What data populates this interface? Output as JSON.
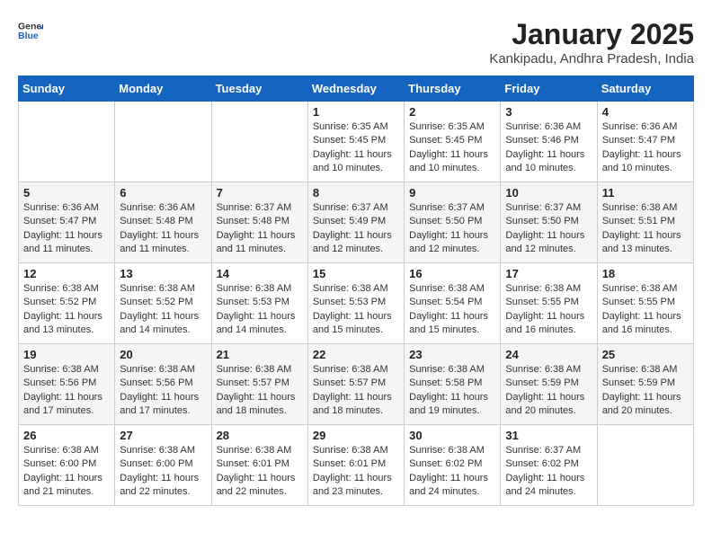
{
  "header": {
    "logo_general": "General",
    "logo_blue": "Blue",
    "title": "January 2025",
    "subtitle": "Kankipadu, Andhra Pradesh, India"
  },
  "weekdays": [
    "Sunday",
    "Monday",
    "Tuesday",
    "Wednesday",
    "Thursday",
    "Friday",
    "Saturday"
  ],
  "weeks": [
    [
      {
        "day": "",
        "info": ""
      },
      {
        "day": "",
        "info": ""
      },
      {
        "day": "",
        "info": ""
      },
      {
        "day": "1",
        "info": "Sunrise: 6:35 AM\nSunset: 5:45 PM\nDaylight: 11 hours and 10 minutes."
      },
      {
        "day": "2",
        "info": "Sunrise: 6:35 AM\nSunset: 5:45 PM\nDaylight: 11 hours and 10 minutes."
      },
      {
        "day": "3",
        "info": "Sunrise: 6:36 AM\nSunset: 5:46 PM\nDaylight: 11 hours and 10 minutes."
      },
      {
        "day": "4",
        "info": "Sunrise: 6:36 AM\nSunset: 5:47 PM\nDaylight: 11 hours and 10 minutes."
      }
    ],
    [
      {
        "day": "5",
        "info": "Sunrise: 6:36 AM\nSunset: 5:47 PM\nDaylight: 11 hours and 11 minutes."
      },
      {
        "day": "6",
        "info": "Sunrise: 6:36 AM\nSunset: 5:48 PM\nDaylight: 11 hours and 11 minutes."
      },
      {
        "day": "7",
        "info": "Sunrise: 6:37 AM\nSunset: 5:48 PM\nDaylight: 11 hours and 11 minutes."
      },
      {
        "day": "8",
        "info": "Sunrise: 6:37 AM\nSunset: 5:49 PM\nDaylight: 11 hours and 12 minutes."
      },
      {
        "day": "9",
        "info": "Sunrise: 6:37 AM\nSunset: 5:50 PM\nDaylight: 11 hours and 12 minutes."
      },
      {
        "day": "10",
        "info": "Sunrise: 6:37 AM\nSunset: 5:50 PM\nDaylight: 11 hours and 12 minutes."
      },
      {
        "day": "11",
        "info": "Sunrise: 6:38 AM\nSunset: 5:51 PM\nDaylight: 11 hours and 13 minutes."
      }
    ],
    [
      {
        "day": "12",
        "info": "Sunrise: 6:38 AM\nSunset: 5:52 PM\nDaylight: 11 hours and 13 minutes."
      },
      {
        "day": "13",
        "info": "Sunrise: 6:38 AM\nSunset: 5:52 PM\nDaylight: 11 hours and 14 minutes."
      },
      {
        "day": "14",
        "info": "Sunrise: 6:38 AM\nSunset: 5:53 PM\nDaylight: 11 hours and 14 minutes."
      },
      {
        "day": "15",
        "info": "Sunrise: 6:38 AM\nSunset: 5:53 PM\nDaylight: 11 hours and 15 minutes."
      },
      {
        "day": "16",
        "info": "Sunrise: 6:38 AM\nSunset: 5:54 PM\nDaylight: 11 hours and 15 minutes."
      },
      {
        "day": "17",
        "info": "Sunrise: 6:38 AM\nSunset: 5:55 PM\nDaylight: 11 hours and 16 minutes."
      },
      {
        "day": "18",
        "info": "Sunrise: 6:38 AM\nSunset: 5:55 PM\nDaylight: 11 hours and 16 minutes."
      }
    ],
    [
      {
        "day": "19",
        "info": "Sunrise: 6:38 AM\nSunset: 5:56 PM\nDaylight: 11 hours and 17 minutes."
      },
      {
        "day": "20",
        "info": "Sunrise: 6:38 AM\nSunset: 5:56 PM\nDaylight: 11 hours and 17 minutes."
      },
      {
        "day": "21",
        "info": "Sunrise: 6:38 AM\nSunset: 5:57 PM\nDaylight: 11 hours and 18 minutes."
      },
      {
        "day": "22",
        "info": "Sunrise: 6:38 AM\nSunset: 5:57 PM\nDaylight: 11 hours and 18 minutes."
      },
      {
        "day": "23",
        "info": "Sunrise: 6:38 AM\nSunset: 5:58 PM\nDaylight: 11 hours and 19 minutes."
      },
      {
        "day": "24",
        "info": "Sunrise: 6:38 AM\nSunset: 5:59 PM\nDaylight: 11 hours and 20 minutes."
      },
      {
        "day": "25",
        "info": "Sunrise: 6:38 AM\nSunset: 5:59 PM\nDaylight: 11 hours and 20 minutes."
      }
    ],
    [
      {
        "day": "26",
        "info": "Sunrise: 6:38 AM\nSunset: 6:00 PM\nDaylight: 11 hours and 21 minutes."
      },
      {
        "day": "27",
        "info": "Sunrise: 6:38 AM\nSunset: 6:00 PM\nDaylight: 11 hours and 22 minutes."
      },
      {
        "day": "28",
        "info": "Sunrise: 6:38 AM\nSunset: 6:01 PM\nDaylight: 11 hours and 22 minutes."
      },
      {
        "day": "29",
        "info": "Sunrise: 6:38 AM\nSunset: 6:01 PM\nDaylight: 11 hours and 23 minutes."
      },
      {
        "day": "30",
        "info": "Sunrise: 6:38 AM\nSunset: 6:02 PM\nDaylight: 11 hours and 24 minutes."
      },
      {
        "day": "31",
        "info": "Sunrise: 6:37 AM\nSunset: 6:02 PM\nDaylight: 11 hours and 24 minutes."
      },
      {
        "day": "",
        "info": ""
      }
    ]
  ]
}
